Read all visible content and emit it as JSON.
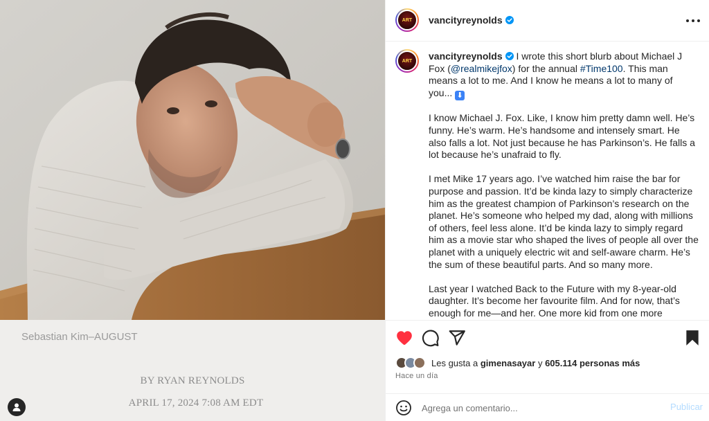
{
  "post": {
    "credit": "Sebastian Kim–AUGUST",
    "byline": "BY RYAN REYNOLDS",
    "dateline": "APRIL 17, 2024 7:08 AM EDT"
  },
  "header": {
    "username": "vancityreynolds"
  },
  "caption": {
    "username": "vancityreynolds",
    "intro": "I wrote this short blurb about Michael J Fox (",
    "mention": "@realmikejfox",
    "mid": ") for the annual ",
    "hashtag": "#Time100",
    "outro": ". This man means a lot to me. And I know he means a lot to many of you... ",
    "arrow": "⬇",
    "p2": "I know Michael J. Fox. Like, I know him pretty damn well. He’s funny. He’s warm. He’s handsome and intensely smart. He also falls a lot. Not just because he has Parkinson’s. He falls a lot because he’s unafraid to fly.",
    "p3": "I met Mike 17 years ago. I’ve watched him raise the bar for purpose and passion. It’d be kinda lazy to simply characterize him as the greatest champion of Parkinson’s research on the planet. He’s someone who helped my dad, along with millions of others, feel less alone. It’d be kinda lazy to simply regard him as a movie star who shaped the lives of people all over the planet with a uniquely electric wit and self-aware charm. He’s the sum of these beautiful parts. And so many more.",
    "p4": "Last year I watched Back to the Future with my 8-year-old daughter. It’s become her favourite film. And for now, that’s enough for me—and her. One more kid from one more generation sees what I saw."
  },
  "likes": {
    "prefix": "Les gusta a ",
    "user": "gimenasayar",
    "joiner": " y ",
    "count": "605.114 personas más"
  },
  "timestamp": "Hace un día",
  "comment_box": {
    "placeholder": "Agrega un comentario...",
    "publish_label": "Publicar"
  },
  "colors": {
    "like_red": "#ff3040",
    "link_blue": "#00376b",
    "verified_blue": "#0095f6",
    "publish_disabled": "#b3dbff"
  },
  "icons": {
    "like": "heart-filled-icon",
    "comment": "comment-bubble-icon",
    "share": "paper-plane-icon",
    "save": "bookmark-filled-icon",
    "more": "more-dots-icon",
    "emoji": "smiley-icon",
    "tag": "user-tag-icon",
    "verified": "verified-badge-icon"
  }
}
